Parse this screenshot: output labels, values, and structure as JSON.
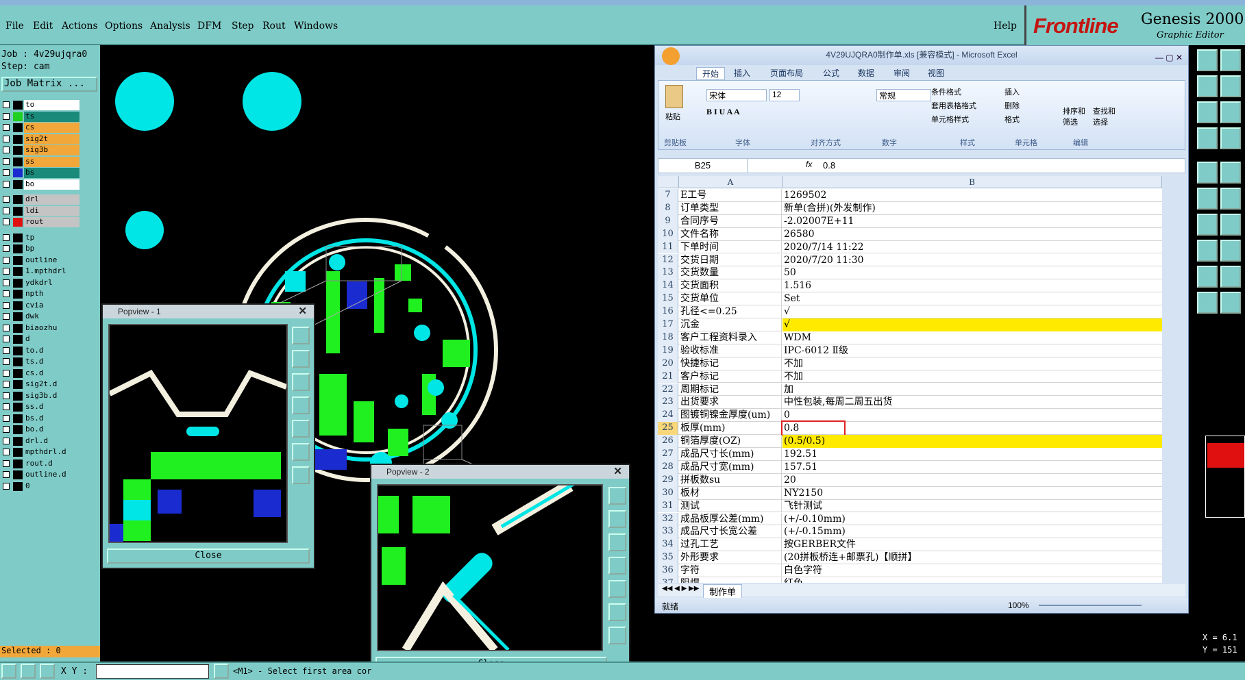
{
  "menu": {
    "items": [
      "File",
      "Edit",
      "Actions",
      "Options",
      "Analysis",
      "DFM",
      "Step",
      "Rout",
      "Windows"
    ],
    "help": "Help"
  },
  "logo": {
    "brand": "Frontline",
    "product": "Genesis 2000",
    "subtitle": "Graphic Editor"
  },
  "job": {
    "job_line": "Job : 4v29ujqra0",
    "step_line": "Step: cam",
    "matrix_button": "Job Matrix ..."
  },
  "layers": [
    {
      "name": "to",
      "color": "#ffffff",
      "swatch": "#000000"
    },
    {
      "name": "ts",
      "color": "#1a8a7a",
      "swatch": "#20d020"
    },
    {
      "name": "cs",
      "color": "#f2a73b",
      "swatch": "#000000"
    },
    {
      "name": "sig2t",
      "color": "#f2a73b",
      "swatch": "#000000"
    },
    {
      "name": "sig3b",
      "color": "#f2a73b",
      "swatch": "#000000"
    },
    {
      "name": "ss",
      "color": "#f2a73b",
      "swatch": "#000000"
    },
    {
      "name": "bs",
      "color": "#1a8a7a",
      "swatch": "#1a2bd0"
    },
    {
      "name": "bo",
      "color": "#ffffff",
      "swatch": "#000000"
    },
    {
      "name": "drl",
      "color": "#c4c4c4",
      "swatch": "#000000"
    },
    {
      "name": "ldi",
      "color": "#c4c4c4",
      "swatch": "#000000"
    },
    {
      "name": "rout",
      "color": "#c4c4c4",
      "swatch": "#e01010"
    },
    {
      "name": "tp",
      "color": "#7fcbc7",
      "swatch": "#000000"
    },
    {
      "name": "bp",
      "color": "#7fcbc7",
      "swatch": "#000000"
    },
    {
      "name": "outline",
      "color": "#7fcbc7",
      "swatch": "#000000"
    },
    {
      "name": "1.mpthdrl",
      "color": "#7fcbc7",
      "swatch": "#000000"
    },
    {
      "name": "ydkdrl",
      "color": "#7fcbc7",
      "swatch": "#000000"
    },
    {
      "name": "npth",
      "color": "#7fcbc7",
      "swatch": "#000000"
    },
    {
      "name": "cvia",
      "color": "#7fcbc7",
      "swatch": "#000000"
    },
    {
      "name": "dwk",
      "color": "#7fcbc7",
      "swatch": "#000000"
    },
    {
      "name": "biaozhu",
      "color": "#7fcbc7",
      "swatch": "#000000"
    },
    {
      "name": "d",
      "color": "#7fcbc7",
      "swatch": "#000000"
    },
    {
      "name": "to.d",
      "color": "#7fcbc7",
      "swatch": "#000000"
    },
    {
      "name": "ts.d",
      "color": "#7fcbc7",
      "swatch": "#000000"
    },
    {
      "name": "cs.d",
      "color": "#7fcbc7",
      "swatch": "#000000"
    },
    {
      "name": "sig2t.d",
      "color": "#7fcbc7",
      "swatch": "#000000"
    },
    {
      "name": "sig3b.d",
      "color": "#7fcbc7",
      "swatch": "#000000"
    },
    {
      "name": "ss.d",
      "color": "#7fcbc7",
      "swatch": "#000000"
    },
    {
      "name": "bs.d",
      "color": "#7fcbc7",
      "swatch": "#000000"
    },
    {
      "name": "bo.d",
      "color": "#7fcbc7",
      "swatch": "#000000"
    },
    {
      "name": "drl.d",
      "color": "#7fcbc7",
      "swatch": "#000000"
    },
    {
      "name": "mpthdrl.d",
      "color": "#7fcbc7",
      "swatch": "#000000"
    },
    {
      "name": "rout.d",
      "color": "#7fcbc7",
      "swatch": "#000000"
    },
    {
      "name": "outline.d",
      "color": "#7fcbc7",
      "swatch": "#000000"
    },
    {
      "name": "0",
      "color": "#7fcbc7",
      "swatch": "#000000"
    }
  ],
  "selected": "Selected : 0",
  "bottom": {
    "xy_label": "X Y :",
    "status": "<M1> - Select first area cor"
  },
  "popview1": {
    "title": "Popview - 1",
    "close": "Close"
  },
  "popview2": {
    "title": "Popview - 2",
    "close": "Close"
  },
  "coords": {
    "x": "X = 6.1",
    "y": "Y = 151"
  },
  "excel": {
    "title": "4V29UJQRA0制作单.xls  [兼容模式] - Microsoft Excel",
    "tabs": [
      "开始",
      "插入",
      "页面布局",
      "公式",
      "数据",
      "审阅",
      "视图"
    ],
    "groups": [
      "剪贴板",
      "字体",
      "对齐方式",
      "数字",
      "样式",
      "单元格",
      "编辑"
    ],
    "font_name": "宋体",
    "font_size": "12",
    "number_format": "常规",
    "paste": "粘贴",
    "style_items": [
      "条件格式",
      "套用表格格式",
      "单元格样式"
    ],
    "cell_items": [
      "插入",
      "删除",
      "格式"
    ],
    "edit_items": [
      "排序和筛选",
      "查找和选择"
    ],
    "name_box": "B25",
    "fx": "fx",
    "formula": "0.8",
    "col_a": "A",
    "col_b": "B",
    "rows": [
      {
        "n": "7",
        "a": "E工号",
        "b": "1269502"
      },
      {
        "n": "8",
        "a": "订单类型",
        "b": "新单(合拼)(外发制作)"
      },
      {
        "n": "9",
        "a": "合同序号",
        "b": "-2.02007E+11"
      },
      {
        "n": "10",
        "a": "文件名称",
        "b": "26580"
      },
      {
        "n": "11",
        "a": "下单时间",
        "b": "2020/7/14 11:22"
      },
      {
        "n": "12",
        "a": "交货日期",
        "b": "2020/7/20 11:30"
      },
      {
        "n": "13",
        "a": "交货数量",
        "b": "50"
      },
      {
        "n": "14",
        "a": "交货面积",
        "b": "1.516"
      },
      {
        "n": "15",
        "a": "交货单位",
        "b": "Set"
      },
      {
        "n": "16",
        "a": "孔径<=0.25",
        "b": "√"
      },
      {
        "n": "17",
        "a": "沉金",
        "b": "√",
        "hl": true
      },
      {
        "n": "18",
        "a": "客户工程资料录入",
        "b": "WDM"
      },
      {
        "n": "19",
        "a": "验收标准",
        "b": "IPC-6012 Ⅱ级"
      },
      {
        "n": "20",
        "a": "快捷标记",
        "b": "不加"
      },
      {
        "n": "21",
        "a": "客户标记",
        "b": "不加"
      },
      {
        "n": "22",
        "a": "周期标记",
        "b": "加"
      },
      {
        "n": "23",
        "a": "出货要求",
        "b": "中性包装,每周二周五出货"
      },
      {
        "n": "24",
        "a": "图镀铜镍金厚度(um)",
        "b": "0"
      },
      {
        "n": "25",
        "a": "板厚(mm)",
        "b": "0.8",
        "sel": true
      },
      {
        "n": "26",
        "a": "铜箔厚度(OZ)",
        "b": "(0.5/0.5)",
        "hl": true
      },
      {
        "n": "27",
        "a": "成品尺寸长(mm)",
        "b": "192.51"
      },
      {
        "n": "28",
        "a": "成品尺寸宽(mm)",
        "b": "157.51"
      },
      {
        "n": "29",
        "a": "拼板数su",
        "b": "20"
      },
      {
        "n": "30",
        "a": "板材",
        "b": "NY2150"
      },
      {
        "n": "31",
        "a": "测试",
        "b": "飞针测试"
      },
      {
        "n": "32",
        "a": "成品板厚公差(mm)",
        "b": "(+/-0.10mm)"
      },
      {
        "n": "33",
        "a": "成品尺寸长宽公差",
        "b": "(+/-0.15mm)"
      },
      {
        "n": "34",
        "a": "过孔工艺",
        "b": "按GERBER文件"
      },
      {
        "n": "35",
        "a": "外形要求",
        "b": "(20拼板桥连+邮票孔)【顺拼】"
      },
      {
        "n": "36",
        "a": "字符",
        "b": "白色字符"
      },
      {
        "n": "37",
        "a": "阻焊",
        "b": "红色"
      }
    ],
    "sheet_tab": "制作单",
    "status_ready": "就绪",
    "zoom": "100%"
  }
}
